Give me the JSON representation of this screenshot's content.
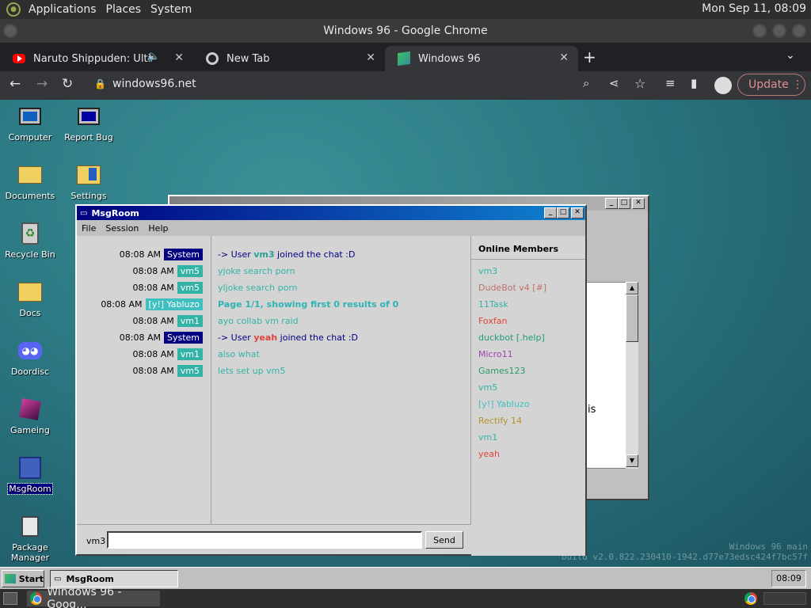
{
  "top_panel": {
    "menus": [
      "Applications",
      "Places",
      "System"
    ],
    "clock": "Mon Sep 11, 08:09"
  },
  "chrome": {
    "window_title": "Windows 96 - Google Chrome",
    "tabs": [
      {
        "title": "Naruto Shippuden: Ultima",
        "favicon": "youtube-icon"
      },
      {
        "title": "New Tab",
        "favicon": "chrome-icon"
      },
      {
        "title": "Windows 96",
        "favicon": "windows96-icon"
      }
    ],
    "url": "windows96.net",
    "update_label": "Update"
  },
  "desktop": {
    "icons": [
      {
        "label": "Computer"
      },
      {
        "label": "Report Bug"
      },
      {
        "label": "Documents"
      },
      {
        "label": "Settings"
      },
      {
        "label": "Recycle Bin"
      },
      {
        "label": "Docs"
      },
      {
        "label": "Doordisc"
      },
      {
        "label": "Gameing"
      },
      {
        "label": "MsgRoom"
      },
      {
        "label": "Package Manager"
      }
    ],
    "watermark_line1": "Windows 96 main",
    "watermark_line2": "build v2.0.822.230410-1942.d77e73edsc424f7bc57f"
  },
  "background_window": {
    "visible_text": "is"
  },
  "msgroom": {
    "title": "MsgRoom",
    "menu": [
      "File",
      "Session",
      "Help"
    ],
    "messages": [
      {
        "time": "08:08 AM",
        "user": "System",
        "user_color": "#000080",
        "parts": [
          "-> User ",
          "vm3",
          " joined the chat :D"
        ],
        "kind": "join",
        "name_color": "#2aa198"
      },
      {
        "time": "08:08 AM",
        "user": "vm5",
        "user_color": "#33b3a6",
        "text": "yjoke search porn",
        "color": "#33b3a6"
      },
      {
        "time": "08:08 AM",
        "user": "vm5",
        "user_color": "#33b3a6",
        "text": "yljoke search porn",
        "color": "#33b3a6"
      },
      {
        "time": "08:08 AM",
        "user": "[y!] Yabluzo",
        "user_color": "#3fbfbf",
        "text": "Page 1/1, showing first 0 results of 0",
        "color": "#2fb3b3",
        "bold": true
      },
      {
        "time": "08:08 AM",
        "user": "vm1",
        "user_color": "#33b3a6",
        "text": "ayo collab vm raid",
        "color": "#33b3a6"
      },
      {
        "time": "08:08 AM",
        "user": "System",
        "user_color": "#000080",
        "parts": [
          "-> User ",
          "yeah",
          " joined the chat :D"
        ],
        "kind": "join",
        "name_color": "#e0443a"
      },
      {
        "time": "08:08 AM",
        "user": "vm1",
        "user_color": "#33b3a6",
        "text": "also what",
        "color": "#33b3a6"
      },
      {
        "time": "08:08 AM",
        "user": "vm5",
        "user_color": "#33b3a6",
        "text": "lets set up vm5",
        "color": "#33b3a6"
      }
    ],
    "members_title": "Online Members",
    "members": [
      {
        "name": "vm3",
        "color": "#33b3a6"
      },
      {
        "name": "DudeBot v4 [#]",
        "color": "#c0716a"
      },
      {
        "name": "11Task",
        "color": "#33b3a6"
      },
      {
        "name": "Foxfan",
        "color": "#e0443a"
      },
      {
        "name": "duckbot [.help]",
        "color": "#1f9a7a"
      },
      {
        "name": "Micro11",
        "color": "#a040b0"
      },
      {
        "name": "Games123",
        "color": "#2a9a6a"
      },
      {
        "name": "vm5",
        "color": "#33b3a6"
      },
      {
        "name": "[y!] Yabluzo",
        "color": "#3fbfbf"
      },
      {
        "name": "Rectify 14",
        "color": "#b8902a"
      },
      {
        "name": "vm1",
        "color": "#33b3a6"
      },
      {
        "name": "yeah",
        "color": "#e0443a"
      }
    ],
    "nick": "vm3",
    "input_value": "",
    "send_label": "Send"
  },
  "w96_taskbar": {
    "start_label": "Start",
    "task_label": "MsgRoom",
    "clock": "08:09"
  },
  "bottom_panel": {
    "task_label": "Windows 96 - Goog..."
  }
}
